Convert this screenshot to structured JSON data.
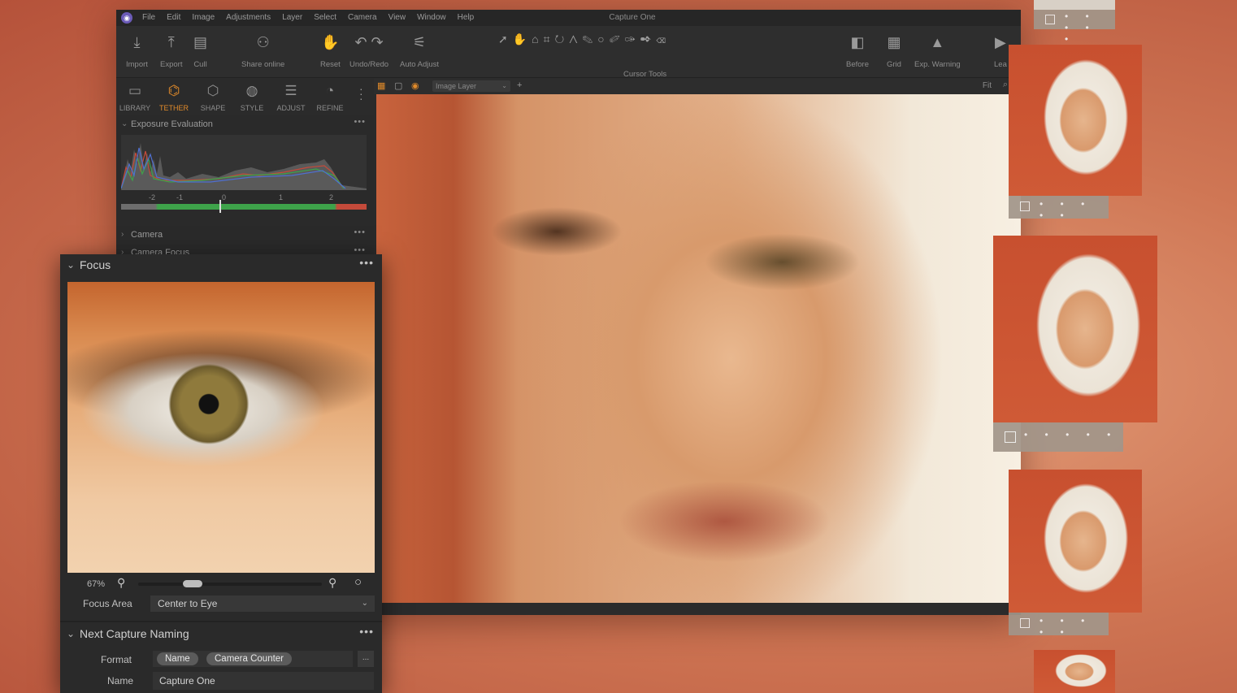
{
  "app": {
    "title": "Capture One",
    "logo": "capture-one-logo-icon",
    "menu": [
      "File",
      "Edit",
      "Image",
      "Adjustments",
      "Layer",
      "Select",
      "Camera",
      "View",
      "Window",
      "Help"
    ]
  },
  "toolbar": {
    "import": "Import",
    "export": "Export",
    "cull": "Cull",
    "share": "Share online",
    "reset": "Reset",
    "undo_redo": "Undo/Redo",
    "auto_adjust": "Auto Adjust",
    "cursor_tools": "Cursor Tools",
    "before": "Before",
    "grid": "Grid",
    "exp_warning": "Exp. Warning",
    "truncated": "Lea"
  },
  "tool_tabs": [
    {
      "label": "LIBRARY",
      "icon": "folder-icon",
      "active": false
    },
    {
      "label": "TETHER",
      "icon": "tether-camera-icon",
      "active": true
    },
    {
      "label": "SHAPE",
      "icon": "shape-icon",
      "active": false
    },
    {
      "label": "STYLE",
      "icon": "style-icon",
      "active": false
    },
    {
      "label": "ADJUST",
      "icon": "sliders-icon",
      "active": false
    },
    {
      "label": "REFINE",
      "icon": "refine-icon",
      "active": false
    }
  ],
  "left_panel": {
    "exposure_evaluation": "Exposure Evaluation",
    "histogram_ticks": [
      "-2",
      "-1",
      "0",
      "1",
      "2"
    ],
    "camera": "Camera",
    "camera_focus": "Camera Focus",
    "dots": "•••"
  },
  "viewer": {
    "layer": "Image Layer",
    "fit": "Fit"
  },
  "focus_panel": {
    "title": "Focus",
    "zoom": "67%",
    "zoom_level": 0.27,
    "focus_area_label": "Focus Area",
    "focus_area_value": "Center to Eye",
    "dots": "•••"
  },
  "naming_panel": {
    "title": "Next Capture Naming",
    "format_label": "Format",
    "tokens": [
      "Name",
      "Camera Counter"
    ],
    "more": "...",
    "name_label": "Name",
    "name_value": "Capture One",
    "dots": "•••"
  },
  "filmstrip": {
    "stars": "• • • • •"
  },
  "colors": {
    "accent": "#e08a2a",
    "panel": "#2a2a2a",
    "background": "#cf7654",
    "histogram_red": "#c44a3a",
    "histogram_green": "#3ea34a"
  }
}
